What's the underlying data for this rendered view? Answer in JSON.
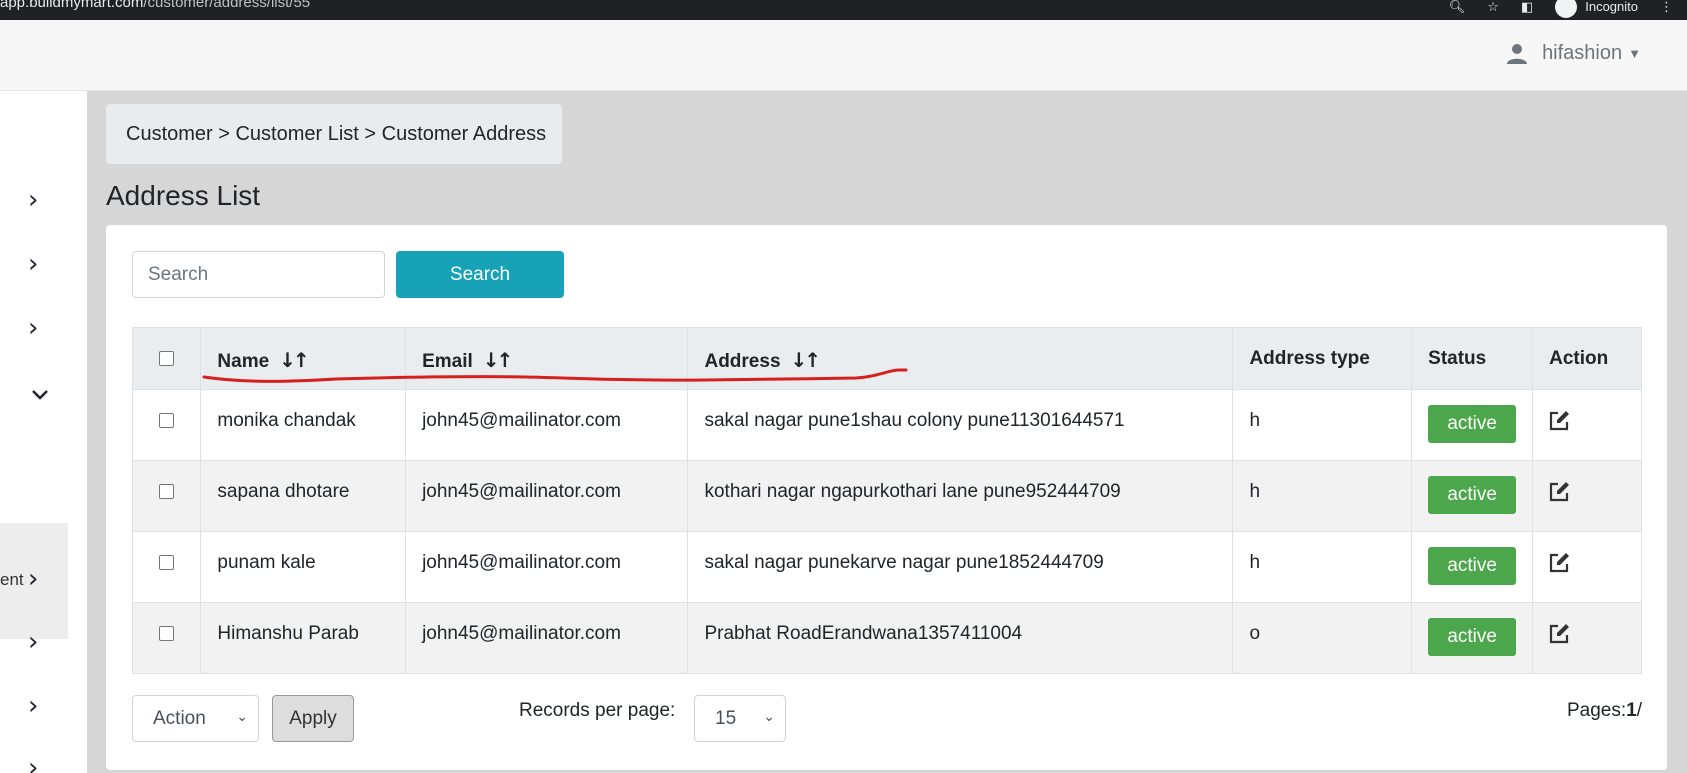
{
  "browser": {
    "url_domain": "app.buildmymart.com",
    "url_path": "/customer/address/list/55",
    "incognito_label": "Incognito"
  },
  "header": {
    "username": "hifashion"
  },
  "sidebar": {
    "partial_label": "ent"
  },
  "breadcrumb": "Customer > Customer List > Customer Address",
  "page_title": "Address List",
  "search": {
    "placeholder": "Search",
    "button_label": "Search"
  },
  "table": {
    "columns": [
      "Name",
      "Email",
      "Address",
      "Address type",
      "Status",
      "Action"
    ],
    "rows": [
      {
        "name": "monika chandak",
        "email": "john45@mailinator.com",
        "address": "sakal nagar pune1shau colony pune11301644571",
        "type": "h",
        "status": "active"
      },
      {
        "name": "sapana dhotare",
        "email": "john45@mailinator.com",
        "address": "kothari nagar ngapurkothari lane pune952444709",
        "type": "h",
        "status": "active"
      },
      {
        "name": "punam kale",
        "email": "john45@mailinator.com",
        "address": "sakal nagar punekarve nagar pune1852444709",
        "type": "h",
        "status": "active"
      },
      {
        "name": "Himanshu Parab",
        "email": "john45@mailinator.com",
        "address": "Prabhat RoadErandwana1357411004",
        "type": "o",
        "status": "active"
      }
    ]
  },
  "footer": {
    "action_select": "Action",
    "apply_label": "Apply",
    "records_label": "Records per page:",
    "per_page": "15",
    "pages_label": "Pages:",
    "pages_value": "1",
    "pages_suffix": "/"
  },
  "colors": {
    "accent": "#17a2b8",
    "active_badge": "#4ca64c",
    "annotation": "#d61f1f"
  }
}
